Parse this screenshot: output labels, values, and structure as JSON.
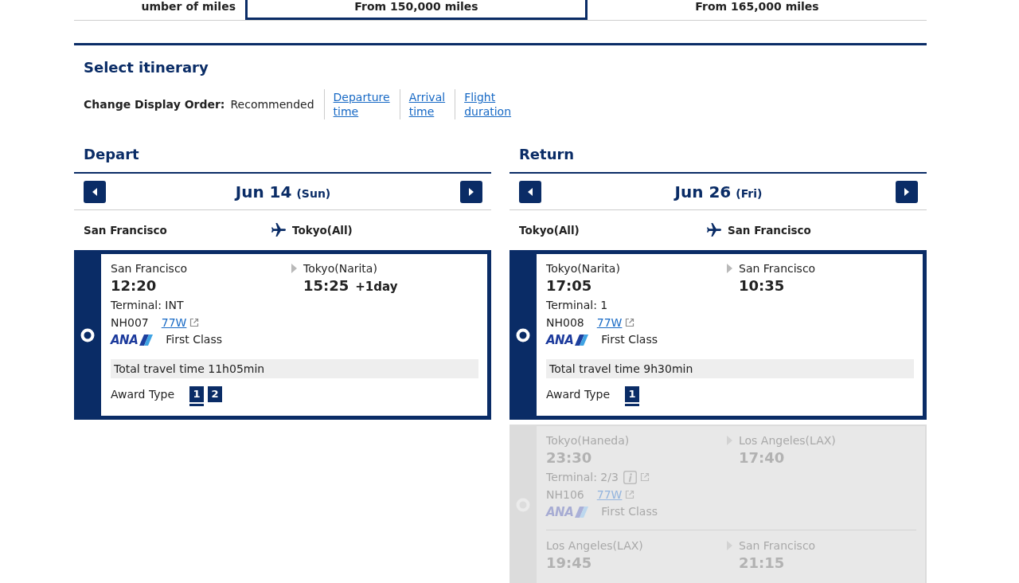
{
  "fare_table": {
    "row_header": "umber of miles",
    "fares": [
      {
        "label": "From 150,000 miles",
        "selected": true
      },
      {
        "label": "From 165,000 miles",
        "selected": false
      }
    ]
  },
  "itinerary": {
    "title": "Select itinerary",
    "sort_label": "Change Display Order:",
    "current_sort": "Recommended",
    "sort_links": [
      "Departure time",
      "Arrival time",
      "Flight duration"
    ]
  },
  "legs": [
    {
      "title": "Depart",
      "date": "Jun 14",
      "weekday": "(Sun)",
      "origin": "San Francisco",
      "destination": "Tokyo(All)",
      "flights": [
        {
          "selected": true,
          "disabled": false,
          "segments": [
            {
              "from": "San Francisco",
              "departure": "12:20",
              "to": "Tokyo(Narita)",
              "arrival": "15:25",
              "day_offset": "+1day",
              "terminal": "Terminal: INT",
              "terminal_info": false,
              "flight_number": "NH007",
              "aircraft": "77W",
              "airline": "ANA",
              "cabin": "First Class"
            }
          ],
          "travel_time": "Total travel time 11h05min",
          "award_label": "Award Type",
          "award_types": [
            {
              "label": "1",
              "selected": true
            },
            {
              "label": "2",
              "selected": false
            }
          ]
        }
      ]
    },
    {
      "title": "Return",
      "date": "Jun 26",
      "weekday": "(Fri)",
      "origin": "Tokyo(All)",
      "destination": "San Francisco",
      "flights": [
        {
          "selected": true,
          "disabled": false,
          "segments": [
            {
              "from": "Tokyo(Narita)",
              "departure": "17:05",
              "to": "San Francisco",
              "arrival": "10:35",
              "terminal": "Terminal: 1",
              "terminal_info": false,
              "flight_number": "NH008",
              "aircraft": "77W",
              "airline": "ANA",
              "cabin": "First Class"
            }
          ],
          "travel_time": "Total travel time 9h30min",
          "award_label": "Award Type",
          "award_types": [
            {
              "label": "1",
              "selected": true
            }
          ]
        },
        {
          "selected": false,
          "disabled": true,
          "segments": [
            {
              "from": "Tokyo(Haneda)",
              "departure": "23:30",
              "to": "Los Angeles(LAX)",
              "arrival": "17:40",
              "terminal": "Terminal: 2/3",
              "terminal_info": true,
              "flight_number": "NH106",
              "aircraft": "77W",
              "airline": "ANA",
              "cabin": "First Class"
            },
            {
              "from": "Los Angeles(LAX)",
              "departure": "19:45",
              "to": "San Francisco",
              "arrival": "21:15"
            }
          ]
        }
      ]
    }
  ]
}
